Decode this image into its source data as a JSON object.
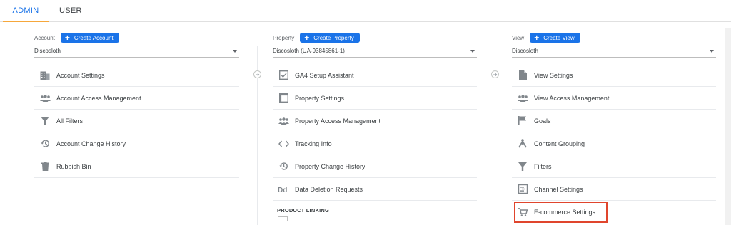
{
  "tabs": {
    "admin": "ADMIN",
    "user": "USER"
  },
  "account": {
    "label": "Account",
    "create_label": "Create Account",
    "selected": "Discosloth",
    "items": [
      {
        "label": "Account Settings",
        "icon": "building-icon"
      },
      {
        "label": "Account Access Management",
        "icon": "people-icon"
      },
      {
        "label": "All Filters",
        "icon": "filter-icon"
      },
      {
        "label": "Account Change History",
        "icon": "history-icon"
      },
      {
        "label": "Rubbish Bin",
        "icon": "trash-icon"
      }
    ]
  },
  "property": {
    "label": "Property",
    "create_label": "Create Property",
    "selected": "Discosloth (UA-93845861-1)",
    "items": [
      {
        "label": "GA4 Setup Assistant",
        "icon": "checkbox-icon"
      },
      {
        "label": "Property Settings",
        "icon": "window-icon"
      },
      {
        "label": "Property Access Management",
        "icon": "people-icon"
      },
      {
        "label": "Tracking Info",
        "icon": "code-icon"
      },
      {
        "label": "Property Change History",
        "icon": "history-icon"
      },
      {
        "label": "Data Deletion Requests",
        "icon": "dd-icon"
      }
    ],
    "section_product_linking": "PRODUCT LINKING"
  },
  "view": {
    "label": "View",
    "create_label": "Create View",
    "selected": "Discosloth",
    "items": [
      {
        "label": "View Settings",
        "icon": "document-icon"
      },
      {
        "label": "View Access Management",
        "icon": "people-icon"
      },
      {
        "label": "Goals",
        "icon": "flag-icon"
      },
      {
        "label": "Content Grouping",
        "icon": "grouping-icon"
      },
      {
        "label": "Filters",
        "icon": "filter-icon"
      },
      {
        "label": "Channel Settings",
        "icon": "channel-icon"
      },
      {
        "label": "E-commerce Settings",
        "icon": "cart-icon"
      }
    ]
  },
  "colors": {
    "accent": "#1a73e8",
    "tab_underline": "#f6a73b",
    "highlight": "#e0452d"
  }
}
